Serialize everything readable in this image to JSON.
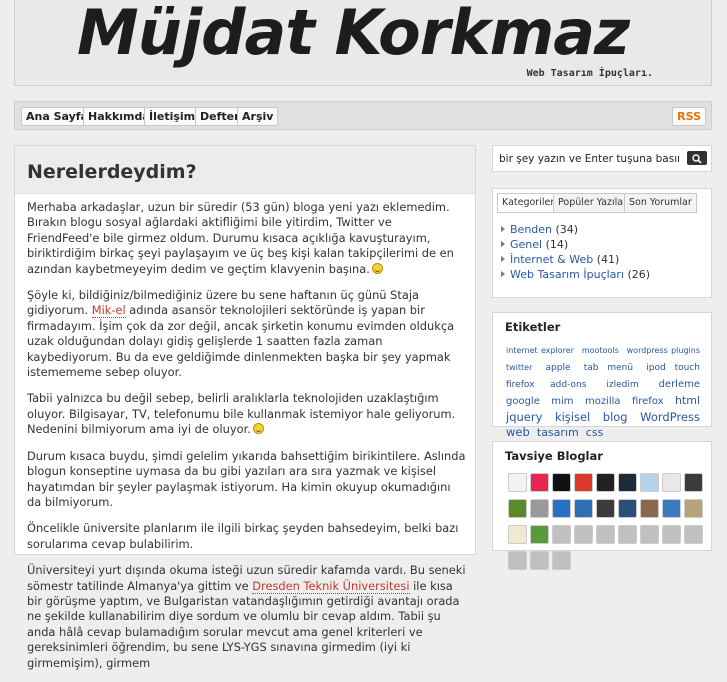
{
  "header": {
    "title": "Müjdat Korkmaz",
    "tagline": "Web Tasarım İpuçları."
  },
  "nav": {
    "items": [
      "Ana Sayfa",
      "Hakkımda",
      "İletişim",
      "Defter",
      "Arşiv"
    ],
    "rss_label": "RSS"
  },
  "post": {
    "title": "Nerelerdeydim?",
    "p1": "Merhaba arkadaşlar, uzun bir süredir (53 gün) bloga yeni yazı eklemedim. Bırakın blogu sosyal ağlardaki aktifliğimi bile yitirdim, Twitter ve FriendFeed'e bile girmez oldum. Durumu kısaca açıklığa kavuşturayım, biriktirdiğim birkaç şeyi paylaşayım ve üç beş kişi kalan takipçilerimi de en azından kaybetmeyeyim dedim ve geçtim klavyenin başına.",
    "p2_before": "Şöyle ki, bildiğiniz/bilmediğiniz üzere bu sene haftanın üç günü Staja gidiyorum. ",
    "p2_link": "Mik-el",
    "p2_after": " adında asansör teknolojileri sektöründe iş yapan bir firmadayım. İşim çok da zor değil, ancak şirketin konumu evimden oldukça uzak olduğundan dolayı gidiş gelişlerde 1 saatten fazla zaman kaybediyorum. Bu da eve geldiğimde dinlenmekten başka bir şey yapmak istemememe sebep oluyor.",
    "p3": "Tabii yalnızca bu değil sebep, belirli aralıklarla teknolojiden uzaklaştığım oluyor. Bilgisayar, TV, telefonumu bile kullanmak istemiyor hale geliyorum. Nedenini bilmiyorum ama iyi de oluyor.",
    "p4": "Durum kısaca buydu, şimdi gelelim yıkarıda bahsettiğim birikintilere. Aslında blogun konseptine uymasa da bu gibi yazıları ara sıra yazmak ve kişisel hayatımdan bir şeyler paylaşmak istiyorum. Ha kimin okuyup okumadığını da bilmiyorum.",
    "p5": "Öncelikle üniversite planlarım ile ilgili birkaç şeyden bahsedeyim, belki bazı sorularıma cevap bulabilirim.",
    "p6_before": "Üniversiteyi yurt dışında okuma isteği uzun süredir kafamda vardı. Bu seneki sömestr tatilinde Almanya'ya gittim ve ",
    "p6_link": "Dresden Teknik Üniversitesi",
    "p6_after": " ile kısa bir görüşme yaptım, ve Bulgaristan vatandaşlığımın getirdiği avantajı orada ne şekilde kullanabilirim diye sordum ve olumlu bir cevap aldım. Tabii şu anda hâlâ cevap bulamadığım sorular mevcut ama genel kriterleri ve gereksinimleri öğrendim, bu sene LYS-YGS sınavına girmedim (iyi ki girmemişim), girmem"
  },
  "search": {
    "placeholder": "bir şey yazın ve Enter tuşuna basın..."
  },
  "tabs": [
    "Kategoriler",
    "Popüler Yazılar",
    "Son Yorumlar"
  ],
  "categories": [
    {
      "name": "Benden",
      "count": "(34)"
    },
    {
      "name": "Genel",
      "count": "(14)"
    },
    {
      "name": "İnternet & Web",
      "count": "(41)"
    },
    {
      "name": "Web Tasarım İpuçları",
      "count": "(26)"
    }
  ],
  "tags_box": {
    "title": "Etiketler",
    "tags": [
      {
        "text": "internet explorer",
        "size": 8
      },
      {
        "text": "mootools",
        "size": 8
      },
      {
        "text": "wordpress plugins",
        "size": 8
      },
      {
        "text": "twitter",
        "size": 8
      },
      {
        "text": "apple",
        "size": 9
      },
      {
        "text": "tab menü",
        "size": 9
      },
      {
        "text": "ipod touch",
        "size": 9
      },
      {
        "text": "firefox add-ons",
        "size": 9
      },
      {
        "text": "izledim",
        "size": 9
      },
      {
        "text": "derleme",
        "size": 10
      },
      {
        "text": "google",
        "size": 10
      },
      {
        "text": "mim",
        "size": 10
      },
      {
        "text": "mozilla",
        "size": 10
      },
      {
        "text": "firefox",
        "size": 10
      },
      {
        "text": "html",
        "size": 11
      },
      {
        "text": "jquery",
        "size": 11.5
      },
      {
        "text": "kişisel",
        "size": 11.5
      },
      {
        "text": "blog",
        "size": 11.5
      },
      {
        "text": "WordPress",
        "size": 11.5
      },
      {
        "text": "web",
        "size": 11.5
      },
      {
        "text": "tasarım",
        "size": 11
      },
      {
        "text": "css",
        "size": 11
      }
    ]
  },
  "blogs_box": {
    "title": "Tavsiye Bloglar",
    "icon_colors": [
      "#f2f2f2",
      "#e8254e",
      "#111111",
      "#d93a2b",
      "#222222",
      "#1d2a3a",
      "#b6d2e8",
      "#e8e8e8",
      "#3b3b3b",
      "#5a8a2a",
      "#9a9a9a",
      "#2a6fc2",
      "#2d6fb5",
      "#3b3b3b",
      "#2a4f7a",
      "#8a6a4a",
      "#3a7ac0",
      "#b7a27a",
      "#f0e8d0",
      "#5a9a3a",
      "#c0c0c0",
      "#c0c0c0",
      "#c0c0c0",
      "#c0c0c0",
      "#c0c0c0",
      "#c0c0c0",
      "#c0c0c0",
      "#c0c0c0",
      "#c0c0c0",
      "#c0c0c0"
    ]
  },
  "colors": {
    "link": "#2856a4",
    "post_link": "#c23a2e",
    "rss": "#e2730d"
  }
}
